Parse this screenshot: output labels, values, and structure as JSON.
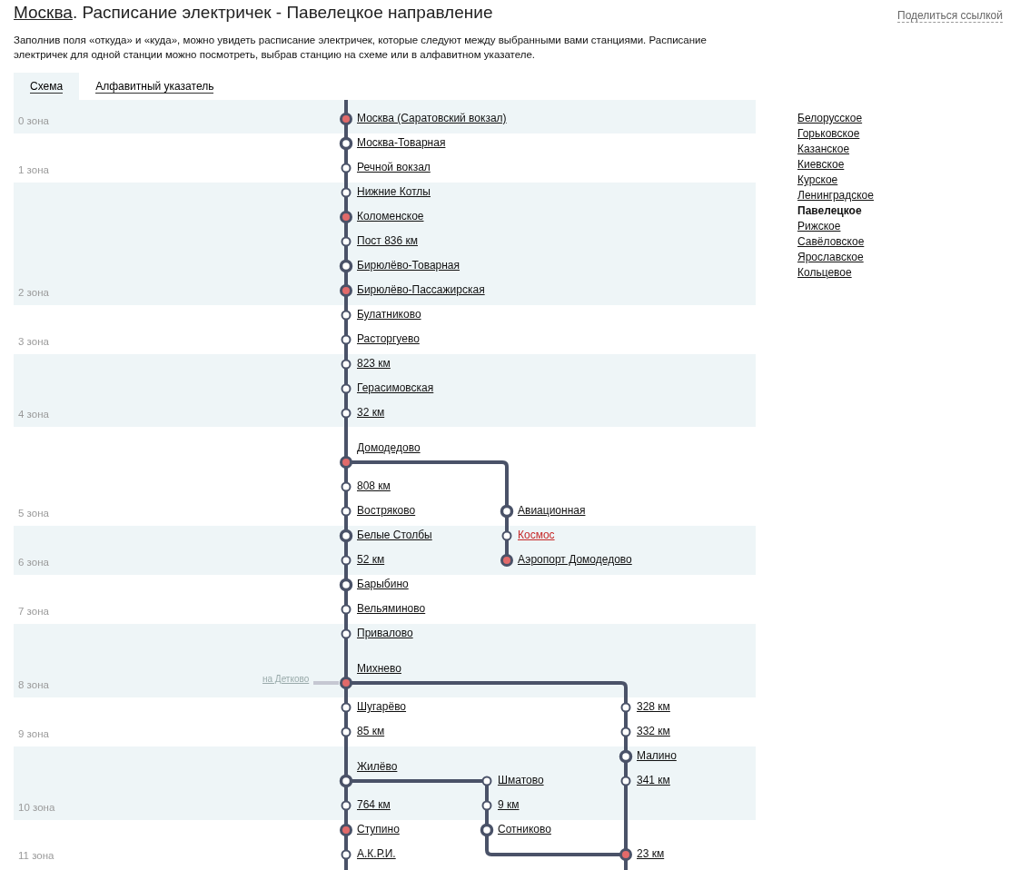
{
  "header": {
    "city_link": "Москва",
    "title": ". Расписание электричек - Павелецкое направление",
    "share_link": "Поделиться ссылкой",
    "description": "Заполнив поля «откуда» и «куда», можно увидеть расписание электричек, которые следуют между выбранными вами станциями. Расписание электричек для одной станции можно посмотреть, выбрав станцию на схеме или в алфавитном указателе."
  },
  "tabs": [
    {
      "label": "Схема",
      "selected": true
    },
    {
      "label": "Алфавитный указатель",
      "selected": false
    }
  ],
  "zones": [
    {
      "label": "0 зона",
      "shaded": true
    },
    {
      "label": "1 зона",
      "shaded": false
    },
    {
      "label": "2 зона",
      "shaded": true
    },
    {
      "label": "3 зона",
      "shaded": false
    },
    {
      "label": "4 зона",
      "shaded": true
    },
    {
      "label": "5 зона",
      "shaded": false
    },
    {
      "label": "6 зона",
      "shaded": true
    },
    {
      "label": "7 зона",
      "shaded": false
    },
    {
      "label": "8 зона",
      "shaded": true
    },
    {
      "label": "9 зона",
      "shaded": false
    },
    {
      "label": "10 зона",
      "shaded": true
    },
    {
      "label": "11 зона",
      "shaded": false
    }
  ],
  "main_line": {
    "stations": [
      {
        "name": "Москва (Саратовский вокзал)",
        "kind": "terminal",
        "highlighted": false
      },
      {
        "name": "Москва-Товарная",
        "kind": "station",
        "highlighted": false
      },
      {
        "name": "Речной вокзал",
        "kind": "stop",
        "highlighted": false
      },
      {
        "name": "Нижние Котлы",
        "kind": "stop",
        "highlighted": false
      },
      {
        "name": "Коломенское",
        "kind": "terminal",
        "highlighted": false
      },
      {
        "name": "Пост 836 км",
        "kind": "stop",
        "highlighted": false
      },
      {
        "name": "Бирюлёво-Товарная",
        "kind": "station",
        "highlighted": false
      },
      {
        "name": "Бирюлёво-Пассажирская",
        "kind": "terminal",
        "highlighted": false
      },
      {
        "name": "Булатниково",
        "kind": "stop",
        "highlighted": false
      },
      {
        "name": "Расторгуево",
        "kind": "stop",
        "highlighted": false
      },
      {
        "name": "823 км",
        "kind": "stop",
        "highlighted": false
      },
      {
        "name": "Герасимовская",
        "kind": "stop",
        "highlighted": false
      },
      {
        "name": "32 км",
        "kind": "stop",
        "highlighted": false
      },
      {
        "name": "Домодедово",
        "kind": "terminal",
        "highlighted": false
      },
      {
        "name": "808 км",
        "kind": "stop",
        "highlighted": false
      },
      {
        "name": "Востряково",
        "kind": "stop",
        "highlighted": false
      },
      {
        "name": "Белые Столбы",
        "kind": "station",
        "highlighted": false
      },
      {
        "name": "52 км",
        "kind": "stop",
        "highlighted": false
      },
      {
        "name": "Барыбино",
        "kind": "station",
        "highlighted": false
      },
      {
        "name": "Вельяминово",
        "kind": "stop",
        "highlighted": false
      },
      {
        "name": "Привалово",
        "kind": "stop",
        "highlighted": false
      },
      {
        "name": "Михнево",
        "kind": "terminal",
        "highlighted": false
      },
      {
        "name": "Шугарёво",
        "kind": "stop",
        "highlighted": false
      },
      {
        "name": "85 км",
        "kind": "stop",
        "highlighted": false
      },
      {
        "name": "Жилёво",
        "kind": "station",
        "highlighted": false
      },
      {
        "name": "764 км",
        "kind": "stop",
        "highlighted": false
      },
      {
        "name": "Ступино",
        "kind": "terminal",
        "highlighted": false
      },
      {
        "name": "А.К.Р.И.",
        "kind": "stop",
        "highlighted": false
      }
    ]
  },
  "side_track": {
    "label": "на Детково"
  },
  "branches": [
    {
      "stations": [
        {
          "name": "Авиационная",
          "kind": "station",
          "highlighted": false
        },
        {
          "name": "Космос",
          "kind": "stop",
          "highlighted": true
        },
        {
          "name": "Аэропорт Домодедово",
          "kind": "terminal",
          "highlighted": false
        }
      ]
    },
    {
      "stations": [
        {
          "name": "328 км",
          "kind": "stop",
          "highlighted": false
        },
        {
          "name": "332 км",
          "kind": "stop",
          "highlighted": false
        },
        {
          "name": "Малино",
          "kind": "station",
          "highlighted": false
        },
        {
          "name": "341 км",
          "kind": "stop",
          "highlighted": false
        },
        {
          "name": "23 км",
          "kind": "terminal",
          "highlighted": false
        }
      ]
    },
    {
      "stations": [
        {
          "name": "Шматово",
          "kind": "stop",
          "highlighted": false
        },
        {
          "name": "9 км",
          "kind": "stop",
          "highlighted": false
        },
        {
          "name": "Сотниково",
          "kind": "station",
          "highlighted": false
        }
      ]
    }
  ],
  "directions": [
    {
      "label": "Белорусское",
      "selected": false
    },
    {
      "label": "Горьковское",
      "selected": false
    },
    {
      "label": "Казанское",
      "selected": false
    },
    {
      "label": "Киевское",
      "selected": false
    },
    {
      "label": "Курское",
      "selected": false
    },
    {
      "label": "Ленинградское",
      "selected": false
    },
    {
      "label": "Павелецкое",
      "selected": true
    },
    {
      "label": "Рижское",
      "selected": false
    },
    {
      "label": "Савёловское",
      "selected": false
    },
    {
      "label": "Ярославское",
      "selected": false
    },
    {
      "label": "Кольцевое",
      "selected": false
    }
  ]
}
